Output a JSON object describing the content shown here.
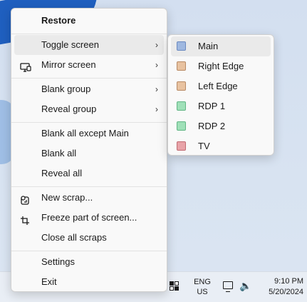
{
  "menu": {
    "items": [
      {
        "label": "Restore",
        "bold": true
      },
      {
        "label": "Toggle screen",
        "has_submenu": true,
        "hovered": true
      },
      {
        "label": "Mirror screen",
        "has_submenu": true,
        "icon": "monitor-icon"
      },
      {
        "label": "Blank group",
        "has_submenu": true
      },
      {
        "label": "Reveal group",
        "has_submenu": true
      },
      {
        "label": "Blank all except Main"
      },
      {
        "label": "Blank all"
      },
      {
        "label": "Reveal all"
      },
      {
        "label": "New scrap...",
        "icon": "scrap-icon"
      },
      {
        "label": "Freeze part of screen...",
        "icon": "crop-icon"
      },
      {
        "label": "Close all scraps"
      },
      {
        "label": "Settings"
      },
      {
        "label": "Exit"
      }
    ],
    "chevron": "›"
  },
  "submenu": {
    "items": [
      {
        "label": "Main",
        "color": "#9fb8e0",
        "border": "#6b8ac0",
        "hovered": true
      },
      {
        "label": "Right Edge",
        "color": "#e8c2a0",
        "border": "#b88a65"
      },
      {
        "label": "Left Edge",
        "color": "#e8c2a0",
        "border": "#b88a65"
      },
      {
        "label": "RDP 1",
        "color": "#9fe0b8",
        "border": "#62b585"
      },
      {
        "label": "RDP 2",
        "color": "#9fe0b8",
        "border": "#62b585"
      },
      {
        "label": "TV",
        "color": "#e8a3a8",
        "border": "#c06b72"
      }
    ]
  },
  "taskbar": {
    "lang_line1": "ENG",
    "lang_line2": "US",
    "time": "9:10 PM",
    "date": "5/20/2024",
    "speaker_glyph": "🔈"
  }
}
